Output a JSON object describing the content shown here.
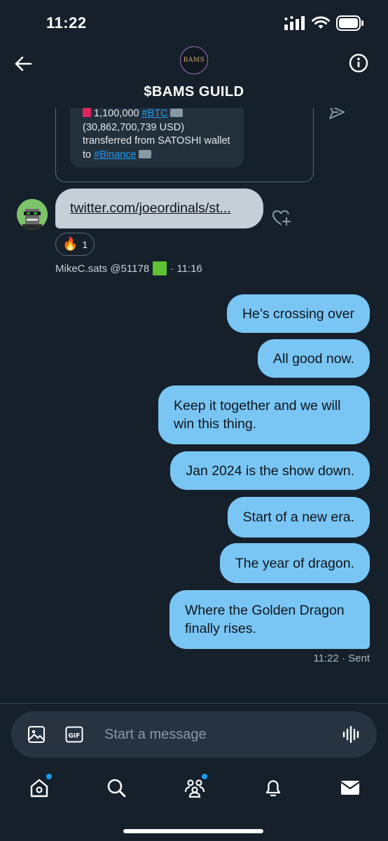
{
  "status_bar": {
    "time": "11:22"
  },
  "header": {
    "title": "$BAMS GUILD",
    "avatar_text": "BAMS"
  },
  "quoted_card": {
    "line1_amount": "1,100,000",
    "line1_tag": "#BTC",
    "line2": "(30,862,700,739 USD)",
    "line3": "transferred from SATOSHI wallet",
    "line4_prefix": "to",
    "line4_tag": "#Binance"
  },
  "incoming": {
    "link_text": "twitter.com/joeordinals/st...",
    "reaction": {
      "emoji": "🔥",
      "count": "1"
    },
    "sender": "MikeC.sats @51178",
    "time": "· 11:16"
  },
  "outgoing_messages": [
    {
      "text": "He’s crossing over"
    },
    {
      "text": "All good now."
    },
    {
      "text": "Keep it together and we will win this thing."
    },
    {
      "text": "Jan 2024 is the show down."
    },
    {
      "text": "Start of a new era."
    },
    {
      "text": "The year of dragon."
    },
    {
      "text": "Where the Golden Dragon finally rises."
    }
  ],
  "outgoing_meta": {
    "time": "11:22",
    "status": "· Sent"
  },
  "composer": {
    "placeholder": "Start a message"
  },
  "colors": {
    "background": "#15202b",
    "bubble_sent": "#79c6f5",
    "bubble_received": "#c4cfd8",
    "link": "#1d9bf0"
  }
}
